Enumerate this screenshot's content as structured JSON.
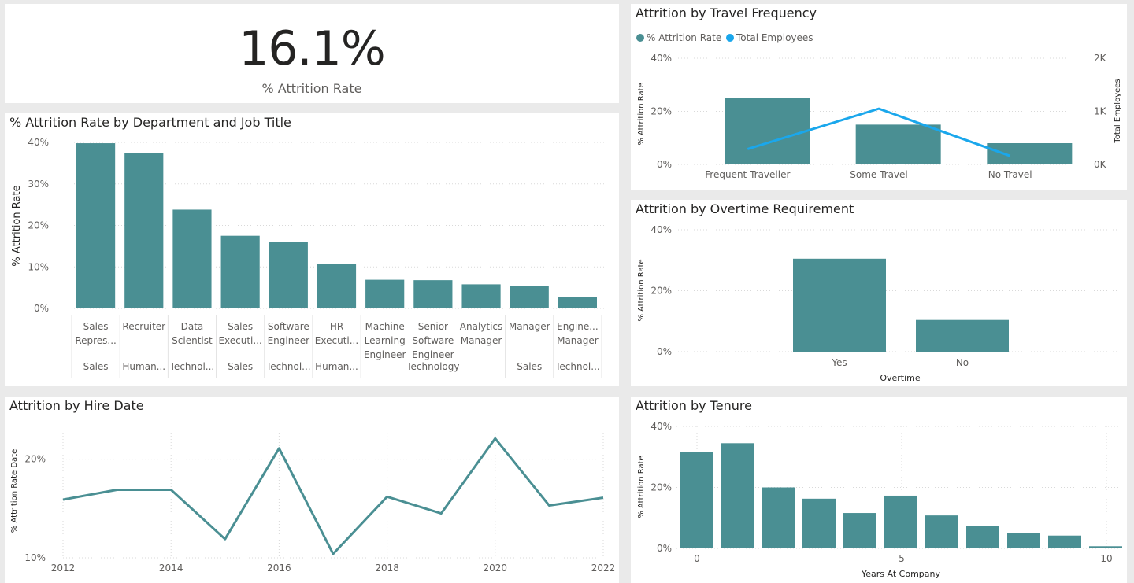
{
  "colors": {
    "bar": "#4a8f93",
    "line": "#4a8f93",
    "secondary_line": "#1aa7ec",
    "grid": "#d9d9d9",
    "axis_text": "#605e5c",
    "background": "#eaeaea",
    "card": "#ffffff"
  },
  "kpi": {
    "value": "16.1%",
    "label": "% Attrition Rate"
  },
  "cards": {
    "department": {
      "title": "% Attrition Rate by Department and Job Title"
    },
    "travel": {
      "title": "Attrition by Travel Frequency"
    },
    "overtime": {
      "title": "Attrition by Overtime Requirement"
    },
    "hire": {
      "title": "Attrition by Hire Date"
    },
    "tenure": {
      "title": "Attrition by Tenure"
    }
  },
  "chart_data": [
    {
      "id": "department",
      "type": "bar",
      "title": "% Attrition Rate by Department and Job Title",
      "xlabel": "",
      "ylabel": "% Attrition Rate",
      "ylim": [
        0,
        40
      ],
      "yticks": [
        "0%",
        "10%",
        "20%",
        "30%",
        "40%"
      ],
      "categories": [
        [
          "Sales",
          "Repres..."
        ],
        [
          "Recruiter"
        ],
        [
          "Data",
          "Scientist"
        ],
        [
          "Sales",
          "Executi..."
        ],
        [
          "Software",
          "Engineer"
        ],
        [
          "HR",
          "Executi..."
        ],
        [
          "Machine",
          "Learning",
          "Engineer"
        ],
        [
          "Senior",
          "Software",
          "Engineer"
        ],
        [
          "Analytics",
          "Manager"
        ],
        [
          "Manager"
        ],
        [
          "Engine...",
          "Manager"
        ]
      ],
      "values": [
        39.8,
        37.5,
        23.8,
        17.5,
        16.0,
        10.7,
        6.9,
        6.8,
        5.8,
        5.4,
        2.7
      ],
      "groups": [
        {
          "label": "Sales",
          "span": [
            0,
            0
          ]
        },
        {
          "label": "Human...",
          "span": [
            1,
            1
          ]
        },
        {
          "label": "Technol...",
          "span": [
            2,
            2
          ]
        },
        {
          "label": "Sales",
          "span": [
            3,
            3
          ]
        },
        {
          "label": "Technol...",
          "span": [
            4,
            4
          ]
        },
        {
          "label": "Human...",
          "span": [
            5,
            5
          ]
        },
        {
          "label": "Technology",
          "span": [
            6,
            8
          ]
        },
        {
          "label": "Sales",
          "span": [
            9,
            9
          ]
        },
        {
          "label": "Technol...",
          "span": [
            10,
            10
          ]
        }
      ],
      "grid": true
    },
    {
      "id": "travel",
      "type": "bar",
      "title": "Attrition by Travel Frequency",
      "xlabel": "",
      "ylabel": "% Attrition Rate",
      "y2label": "Total Employees",
      "ylim": [
        0,
        40
      ],
      "y2lim": [
        0,
        2000
      ],
      "yticks": [
        "0%",
        "20%",
        "40%"
      ],
      "y2ticks": [
        "0K",
        "1K",
        "2K"
      ],
      "categories": [
        "Frequent Traveller",
        "Some Travel",
        "No Travel"
      ],
      "series": [
        {
          "name": "% Attrition Rate",
          "type": "bar",
          "values": [
            24.9,
            15.0,
            8.0
          ]
        },
        {
          "name": "Total Employees",
          "type": "line",
          "values": [
            290,
            1050,
            160
          ]
        }
      ],
      "legend": "top-left",
      "grid": true
    },
    {
      "id": "overtime",
      "type": "bar",
      "title": "Attrition by Overtime Requirement",
      "xlabel": "Overtime",
      "ylabel": "% Attrition Rate",
      "ylim": [
        0,
        40
      ],
      "yticks": [
        "0%",
        "20%",
        "40%"
      ],
      "categories": [
        "Yes",
        "No"
      ],
      "values": [
        30.5,
        10.4
      ],
      "grid": true
    },
    {
      "id": "hire",
      "type": "line",
      "title": "Attrition by Hire Date",
      "xlabel": "",
      "ylabel": "% Attrition Rate Date",
      "ylim": [
        10,
        23
      ],
      "yticks": [
        10,
        20
      ],
      "ytick_labels": [
        "10%",
        "20%"
      ],
      "xticks": [
        2012,
        2014,
        2016,
        2018,
        2020,
        2022
      ],
      "x": [
        2012,
        2013,
        2014,
        2015,
        2016,
        2017,
        2018,
        2019,
        2020,
        2021,
        2022
      ],
      "values": [
        15.9,
        16.9,
        16.9,
        11.9,
        21.1,
        10.4,
        16.2,
        14.5,
        22.1,
        15.3,
        16.1
      ],
      "grid": true
    },
    {
      "id": "tenure",
      "type": "bar",
      "title": "Attrition by Tenure",
      "xlabel": "Years At Company",
      "ylabel": "% Attrition Rate",
      "ylim": [
        0,
        40
      ],
      "yticks": [
        "0%",
        "20%",
        "40%"
      ],
      "xticks": [
        0,
        5,
        10
      ],
      "x": [
        0,
        1,
        2,
        3,
        4,
        5,
        6,
        7,
        8,
        9,
        10
      ],
      "values": [
        31.5,
        34.5,
        20.0,
        16.3,
        11.6,
        17.3,
        10.8,
        7.3,
        5.0,
        4.2,
        0.7
      ],
      "grid": true
    }
  ]
}
